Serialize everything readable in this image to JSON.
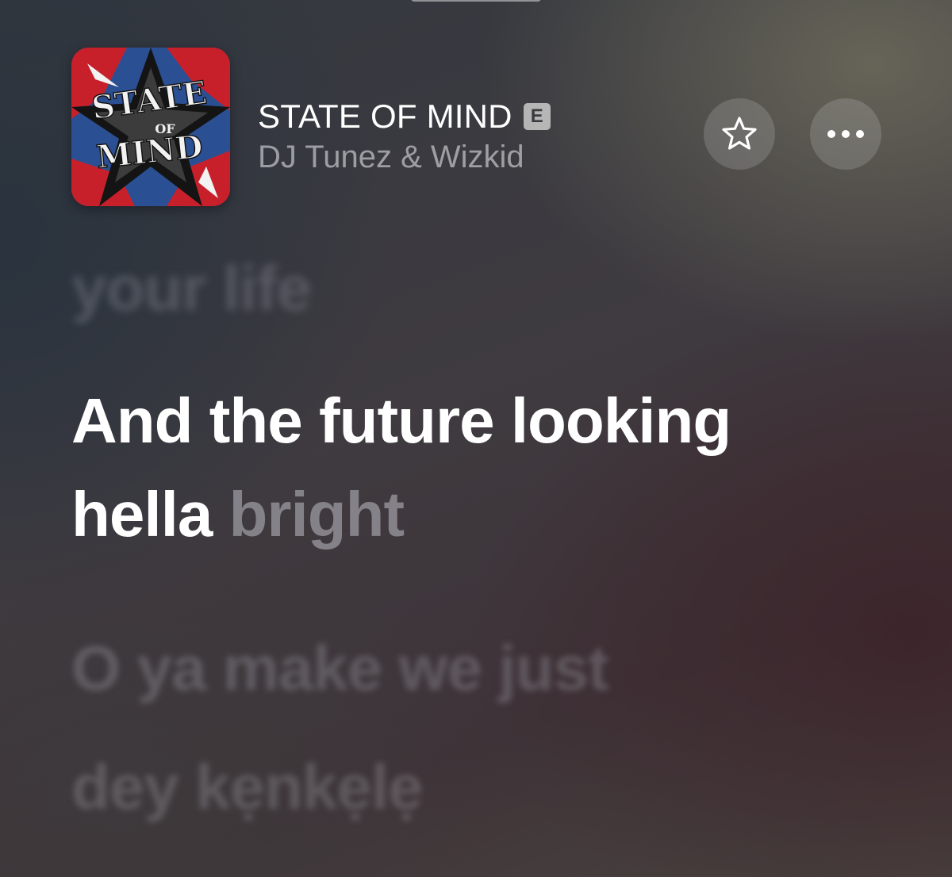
{
  "now_playing": {
    "title": "STATE OF MIND",
    "explicit_badge": "E",
    "artist": "DJ Tunez & Wizkid",
    "artwork": {
      "text_line1": "STATE",
      "text_line2": "OF",
      "text_line3": "MIND",
      "colors": {
        "red": "#c8202a",
        "blue": "#2b4f93",
        "black": "#141414",
        "white": "#f2f2f2"
      }
    }
  },
  "actions": {
    "favorite_icon": "star-icon",
    "more_icon": "ellipsis-icon"
  },
  "lyrics": {
    "previous_line": "your life",
    "current_line_1": "And the future looking",
    "current_line_2_sung": "hella",
    "current_line_2_unsung": "bright",
    "next_line_1": "O ya make we just",
    "next_line_2": "dey kẹnkẹlẹ"
  }
}
